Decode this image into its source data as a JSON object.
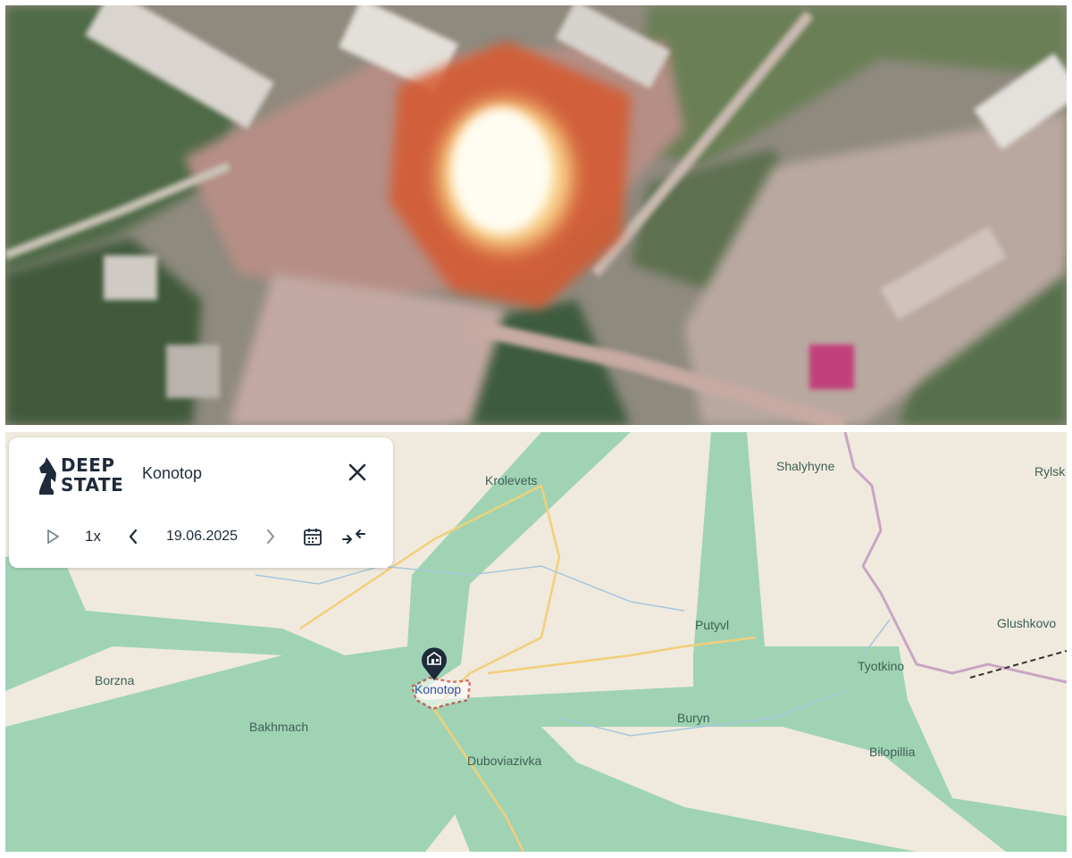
{
  "header": {
    "brand_line1": "DEEP",
    "brand_line2": "STATE",
    "location": "Konotop"
  },
  "playback": {
    "speed": "1x",
    "date": "19.06.2025"
  },
  "icons": {
    "play": "play-icon",
    "prev": "chevron-left-icon",
    "next": "chevron-right-icon",
    "calendar": "calendar-icon",
    "collapse": "collapse-arrows-icon",
    "close": "close-icon",
    "marker": "building-marker-icon",
    "logo": "knight-chess-piece-icon"
  },
  "map": {
    "places": [
      {
        "name": "Krolevets"
      },
      {
        "name": "Shalyhyne"
      },
      {
        "name": "Rylsk"
      },
      {
        "name": "Putyvl"
      },
      {
        "name": "Glushkovo"
      },
      {
        "name": "Tyotkino"
      },
      {
        "name": "Borzna"
      },
      {
        "name": "Konotop"
      },
      {
        "name": "Buryn"
      },
      {
        "name": "Bakhmach"
      },
      {
        "name": "Dubovіazivka"
      },
      {
        "name": "Bilopillia"
      }
    ],
    "colors": {
      "land": "#efeadd",
      "zone": "#9fd3b3",
      "border": "#c9a4c4",
      "road": "#f2cf7a",
      "river": "#a9c6de",
      "marker": "#1f2a3a",
      "target": "#c62828"
    }
  },
  "satellite": {
    "description_colors": {
      "flash": "#fff8d6",
      "fire": "#d6582e"
    }
  }
}
